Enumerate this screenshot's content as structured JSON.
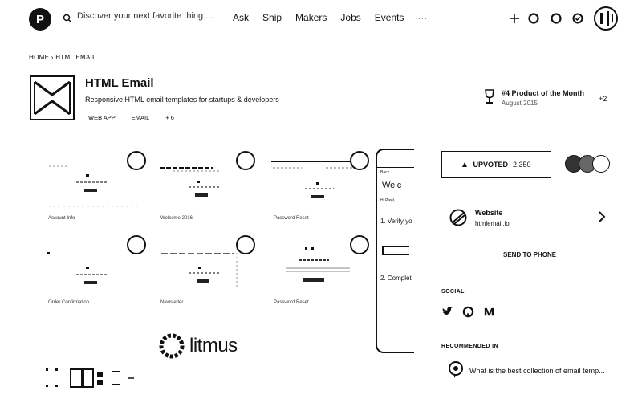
{
  "header": {
    "logo_letter": "P",
    "search_placeholder": "Discover your next favorite thing ...",
    "nav": [
      "Ask",
      "Ship",
      "Makers",
      "Jobs",
      "Events",
      "···"
    ],
    "icons": [
      "plus-icon",
      "bell-icon",
      "circle-icon",
      "badge-icon",
      "avatar"
    ]
  },
  "breadcrumb": "HOME › HTML EMAIL",
  "product": {
    "name": "HTML Email",
    "tagline": "Responsive HTML email templates for startups & developers",
    "tags": [
      "WEB APP",
      "EMAIL",
      "+ 6"
    ]
  },
  "award": {
    "title": "#4 Product of the Month",
    "date": "August 2015",
    "more": "+2"
  },
  "gallery": {
    "cards": [
      {
        "label": "Account Info"
      },
      {
        "label": "Welcome 2016"
      },
      {
        "label": "Password Reset"
      },
      {
        "label": "Order Confirmation"
      },
      {
        "label": "Newsletter"
      },
      {
        "label": "Password Reset"
      }
    ],
    "phone_lines": [
      "Back",
      "Welc",
      "Hi Pixel,",
      "1. Verify yo",
      "2. Complet"
    ],
    "brand": "litmus"
  },
  "sidebar": {
    "upvote_label": "UPVOTED",
    "upvote_count": "2,350",
    "website_label": "Website",
    "website_url": "htmlemail.io",
    "send_to_phone": "SEND TO PHONE",
    "social_heading": "SOCIAL",
    "social_icons": [
      "twitter-icon",
      "github-icon",
      "medium-icon"
    ],
    "recommended_heading": "RECOMMENDED IN",
    "recommended_item": "What is the best collection of email temp..."
  },
  "colors": {
    "ink": "#111111",
    "background": "#ffffff"
  }
}
